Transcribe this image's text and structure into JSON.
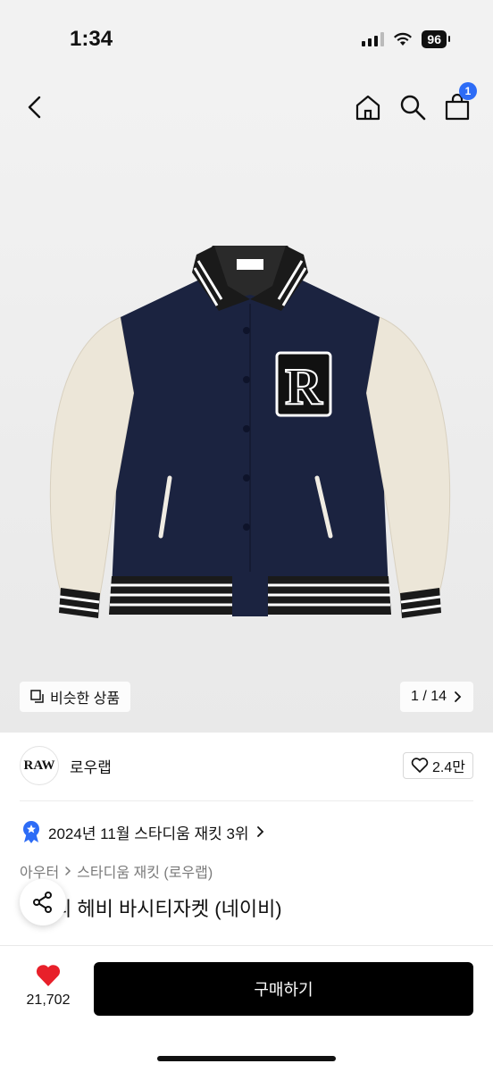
{
  "status_bar": {
    "time": "1:34",
    "battery": "96"
  },
  "header": {
    "cart_count": "1"
  },
  "gallery": {
    "similar_label": "비슷한 상품",
    "pager": "1 / 14"
  },
  "brand": {
    "logo_text": "RAW",
    "name": "로우랩",
    "likes": "2.4만"
  },
  "ranking": {
    "text": "2024년 11월 스타디움 재킷 3위"
  },
  "breadcrumb": {
    "category": "아우터",
    "subcategory": "스타디움 재킷 (로우랩)"
  },
  "product": {
    "title": "리 헤비 바시티자켓 (네이비)"
  },
  "bottom": {
    "wish_count": "21,702",
    "buy_label": "구매하기"
  },
  "colors": {
    "accent": "#2d6cf6",
    "heart": "#e8202a",
    "navy": "#1b2340",
    "cream": "#ece6d8"
  },
  "icons": [
    "back-icon",
    "home-icon",
    "search-icon",
    "bag-icon",
    "similar-icon",
    "chevron-right-icon",
    "heart-outline-icon",
    "ranking-badge-icon",
    "share-icon",
    "heart-filled-icon"
  ]
}
